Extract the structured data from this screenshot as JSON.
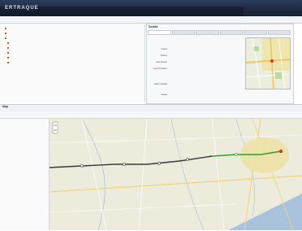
{
  "header": {
    "logo": "ERTRAQUE",
    "links": [
      "",
      "",
      ""
    ]
  },
  "toolbar": {
    "text": ""
  },
  "left_tree": {
    "items": [
      "",
      "",
      "",
      "",
      "",
      "",
      "",
      ""
    ]
  },
  "detail": {
    "title": "Details",
    "tabs": [
      "",
      "",
      "",
      "",
      "",
      ""
    ],
    "fields": [
      {
        "label": "Asset",
        "value": ""
      },
      {
        "label": "Status",
        "value": ""
      },
      {
        "label": "Last Event",
        "value": ""
      },
      {
        "label": "Last Position",
        "value": ""
      },
      {
        "label": "",
        "value": ""
      },
      {
        "label": "",
        "value": ""
      },
      {
        "label": "Last Update",
        "value": ""
      },
      {
        "label": "",
        "value": ""
      },
      {
        "label": "Stops",
        "value": ""
      }
    ],
    "footer": ""
  },
  "map_section": {
    "title": "Map",
    "date_text": ""
  },
  "side_panel": {
    "lines": [
      "",
      "",
      "",
      "",
      ""
    ]
  },
  "colors": {
    "header": "#1c2a40",
    "route": "#3a3a3a",
    "route_recent": "#2da12d",
    "city": "#e8c84a"
  }
}
